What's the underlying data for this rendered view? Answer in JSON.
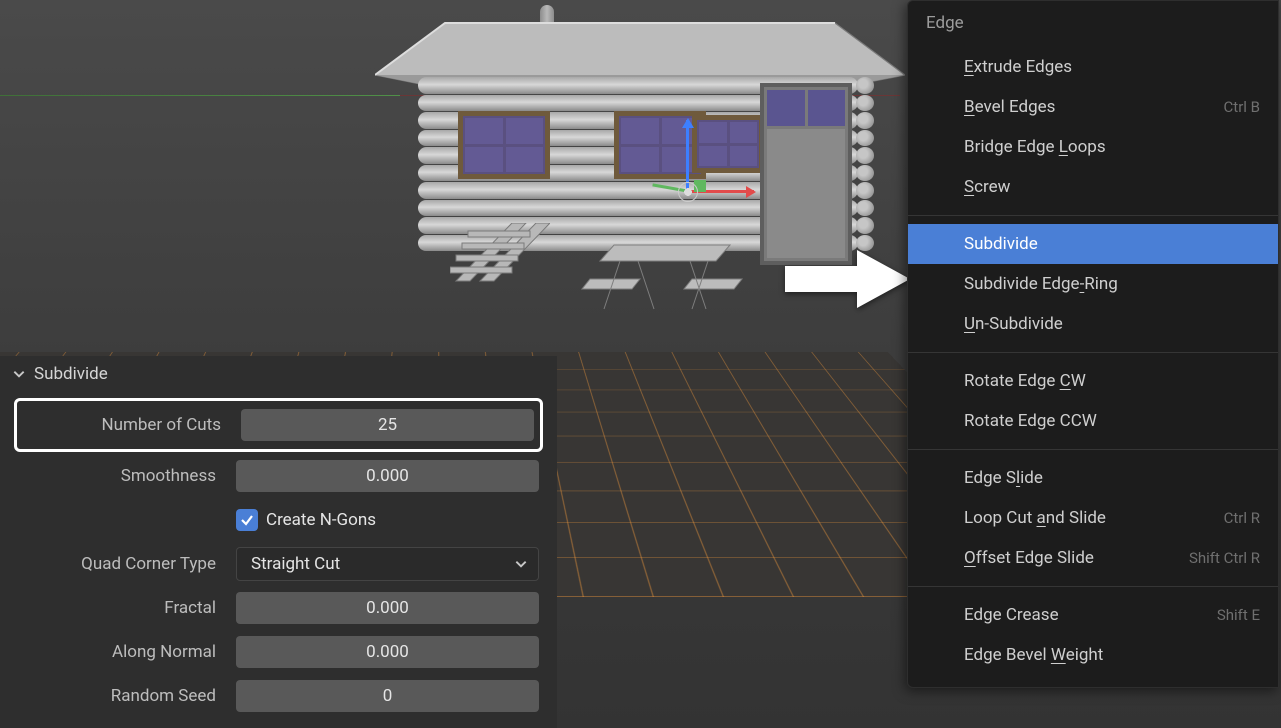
{
  "operator_panel": {
    "title": "Subdivide",
    "rows": {
      "number_of_cuts": {
        "label": "Number of Cuts",
        "value": "25"
      },
      "smoothness": {
        "label": "Smoothness",
        "value": "0.000"
      },
      "create_ngons": {
        "label": "Create N-Gons",
        "checked": true
      },
      "quad_corner": {
        "label": "Quad Corner Type",
        "value": "Straight Cut"
      },
      "fractal": {
        "label": "Fractal",
        "value": "0.000"
      },
      "along_normal": {
        "label": "Along Normal",
        "value": "0.000"
      },
      "random_seed": {
        "label": "Random Seed",
        "value": "0"
      }
    }
  },
  "edge_menu": {
    "title": "Edge",
    "groups": [
      [
        {
          "label": "Extrude Edges",
          "shortcut": "",
          "ul": 0,
          "highlight": false
        },
        {
          "label": "Bevel Edges",
          "shortcut": "Ctrl B",
          "ul": 0,
          "highlight": false
        },
        {
          "label": "Bridge Edge Loops",
          "shortcut": "",
          "ul": 12,
          "highlight": false
        },
        {
          "label": "Screw",
          "shortcut": "",
          "ul": 0,
          "highlight": false
        }
      ],
      [
        {
          "label": "Subdivide",
          "shortcut": "",
          "ul": -1,
          "highlight": true
        },
        {
          "label": "Subdivide Edge-Ring",
          "shortcut": "",
          "ul": 14,
          "highlight": false
        },
        {
          "label": "Un-Subdivide",
          "shortcut": "",
          "ul": 0,
          "highlight": false
        }
      ],
      [
        {
          "label": "Rotate Edge CW",
          "shortcut": "",
          "ul": 12,
          "highlight": false
        },
        {
          "label": "Rotate Edge CCW",
          "shortcut": "",
          "ul": -1,
          "highlight": false
        }
      ],
      [
        {
          "label": "Edge Slide",
          "shortcut": "",
          "ul": 6,
          "highlight": false
        },
        {
          "label": "Loop Cut and Slide",
          "shortcut": "Ctrl R",
          "ul": 9,
          "highlight": false
        },
        {
          "label": "Offset Edge Slide",
          "shortcut": "Shift Ctrl R",
          "ul": 0,
          "highlight": false
        }
      ],
      [
        {
          "label": "Edge Crease",
          "shortcut": "Shift E",
          "ul": -1,
          "highlight": false
        },
        {
          "label": "Edge Bevel Weight",
          "shortcut": "",
          "ul": 11,
          "highlight": false
        }
      ]
    ]
  }
}
